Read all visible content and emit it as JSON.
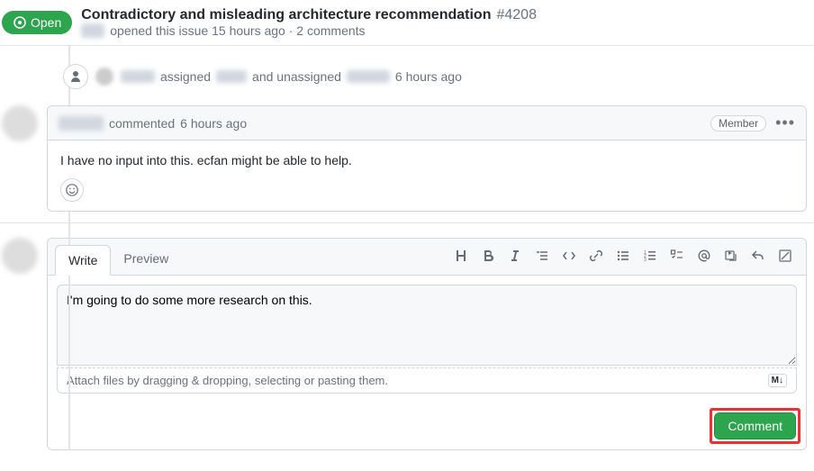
{
  "header": {
    "status": "Open",
    "title": "Contradictory and misleading architecture recommendation",
    "issueNumber": "#4208",
    "openedText": "opened this issue 15 hours ago · 2 comments"
  },
  "assignEvent": {
    "assignedLabel": "assigned",
    "andUnassignedLabel": "and unassigned",
    "timeAgo": "6 hours ago"
  },
  "comment": {
    "action": "commented",
    "timeAgo": "6 hours ago",
    "roleBadge": "Member",
    "body": "I have no input into this. ecfan might be able to help."
  },
  "compose": {
    "tabs": {
      "write": "Write",
      "preview": "Preview"
    },
    "text": "I'm going to do some more research on this.",
    "attachHint": "Attach files by dragging & dropping, selecting or pasting them.",
    "markdownBadge": "M↓",
    "submitLabel": "Comment"
  }
}
